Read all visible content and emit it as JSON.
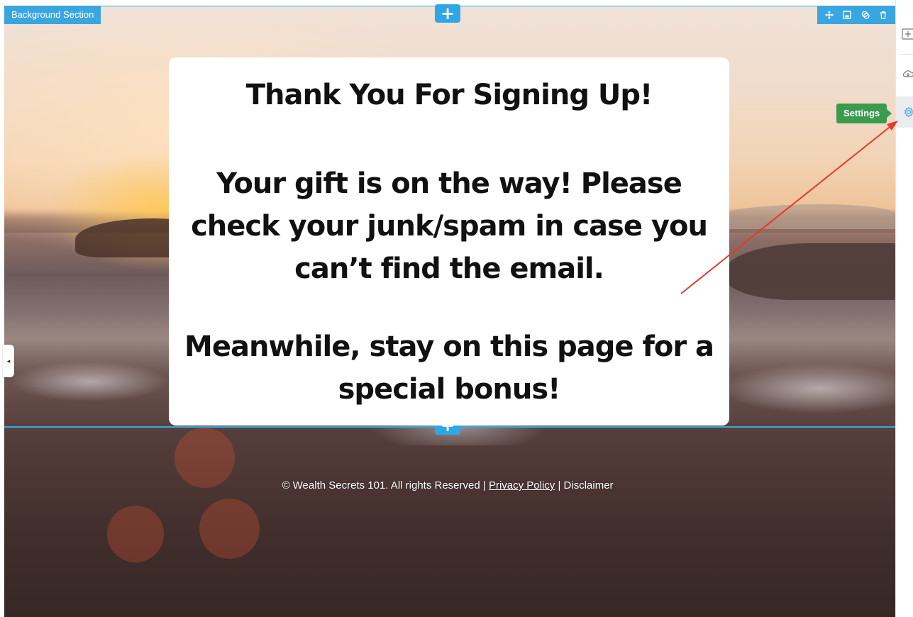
{
  "editor": {
    "section_label": "Background Section",
    "add_section_symbol": "+",
    "section_tools": [
      "move-icon",
      "save-icon",
      "duplicate-icon",
      "delete-icon"
    ],
    "tooltip": "Settings",
    "right_sidebar_icons": [
      "add-element-icon",
      "cloud-icon",
      "gear-icon"
    ],
    "collapse_symbol": "◂",
    "accent_color": "#3aa6e0",
    "tooltip_color": "#3a9a4e",
    "annotation_arrow_color": "#e8392b"
  },
  "content": {
    "title": "Thank You For Signing Up!",
    "gift_message": "Your gift is on the way! Please check your junk/spam in case you can’t find the email.",
    "bonus_message": "Meanwhile, stay on this page for a special bonus!"
  },
  "footer": {
    "copyright": "© Wealth Secrets 101. All rights Reserved",
    "separator": " | ",
    "privacy_link": "Privacy Policy",
    "disclaimer_link": "Disclaimer"
  }
}
